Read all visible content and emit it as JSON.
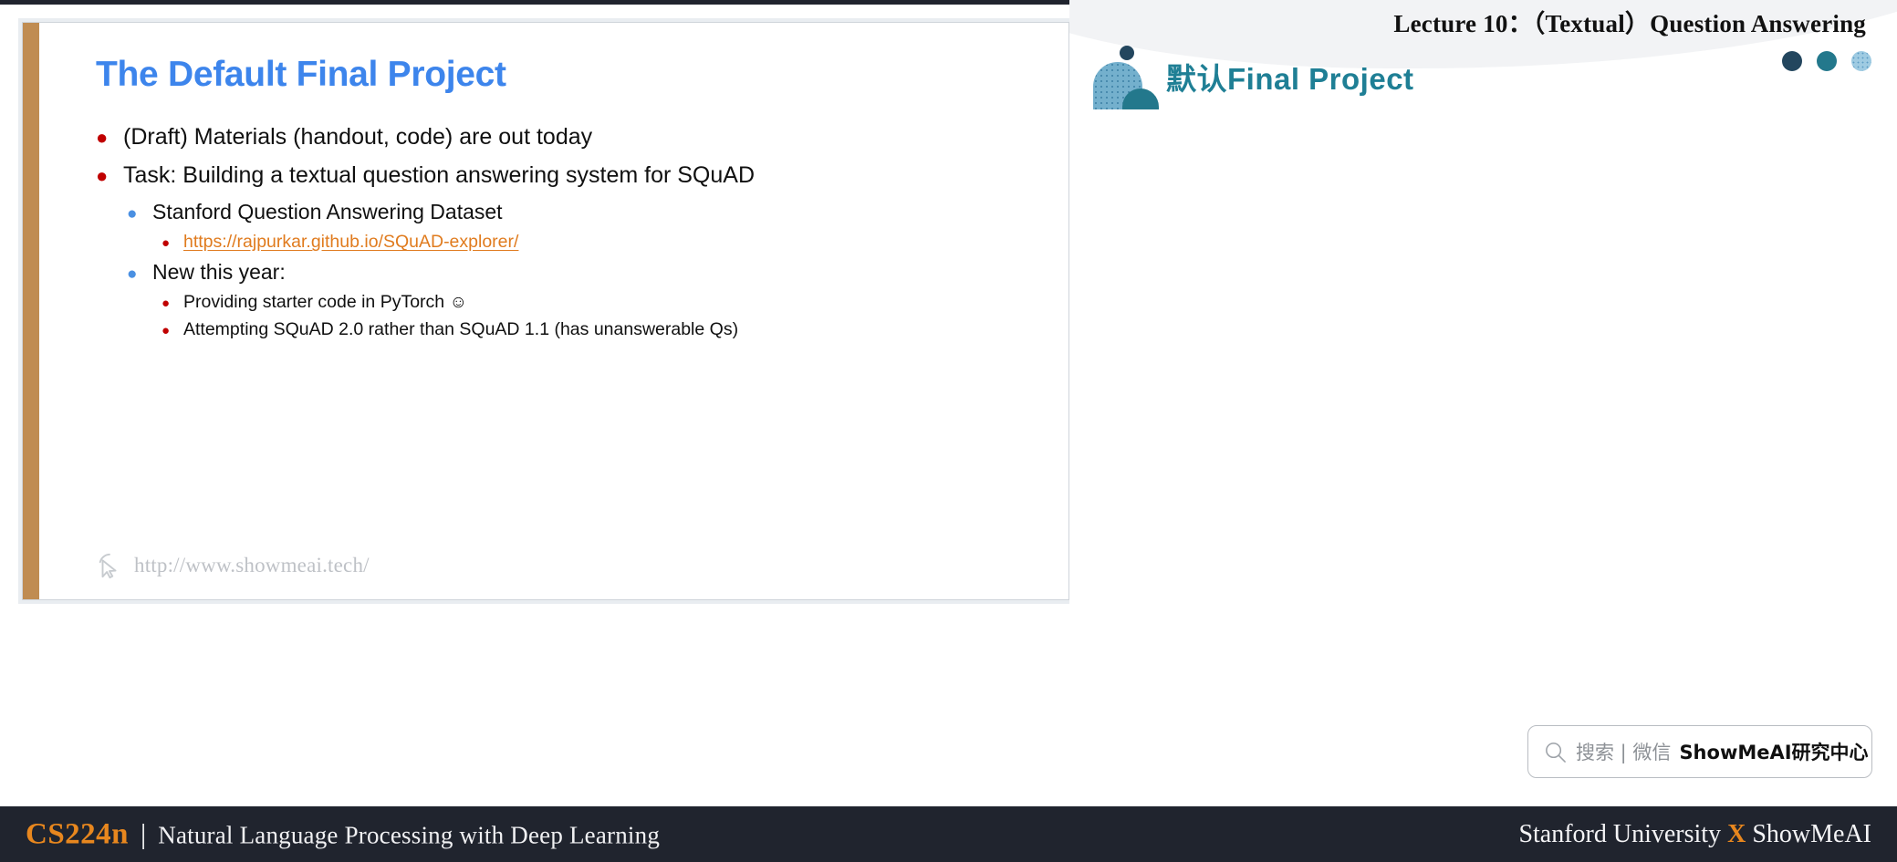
{
  "slide": {
    "title": "The Default Final Project",
    "bullets": [
      {
        "level": 1,
        "text": "(Draft) Materials (handout, code) are out today"
      },
      {
        "level": 1,
        "text": "Task: Building a textual question answering system for SQuAD"
      },
      {
        "level": 2,
        "text": "Stanford Question Answering Dataset"
      },
      {
        "level": 3,
        "text": "https://rajpurkar.github.io/SQuAD-explorer/",
        "link": true
      },
      {
        "level": 2,
        "text": "New this year:"
      },
      {
        "level": 3,
        "text": "Providing starter code in PyTorch",
        "smiley": "☺"
      },
      {
        "level": 3,
        "text": "Attempting SQuAD 2.0 rather than SQuAD 1.1 (has unanswerable Qs)"
      }
    ],
    "watermark": {
      "icon": "cursor-icon",
      "url": "http://www.showmeai.tech/"
    },
    "accent_bar_color": "#c08c52",
    "title_color": "#3d85ec",
    "link_color": "#e07b1e"
  },
  "right_panel": {
    "lecture_title": "Lecture 10：（Textual）Question Answering",
    "logo_text": "默认Final Project",
    "logo_text_color": "#1f7f95",
    "deco_dots": [
      "#23465e",
      "#23788c",
      "#7fb8d4"
    ],
    "search": {
      "icon": "search-icon",
      "placeholder": "搜索 | 微信",
      "brand": "ShowMeAI研究中心"
    }
  },
  "footer": {
    "course_code": "CS224n",
    "separator": "|",
    "course_name": "Natural Language Processing with Deep Learning",
    "right_prefix": "Stanford University ",
    "right_x": "X",
    "right_suffix": " ShowMeAI",
    "accent_color": "#e8871e",
    "background": "#20242e"
  }
}
